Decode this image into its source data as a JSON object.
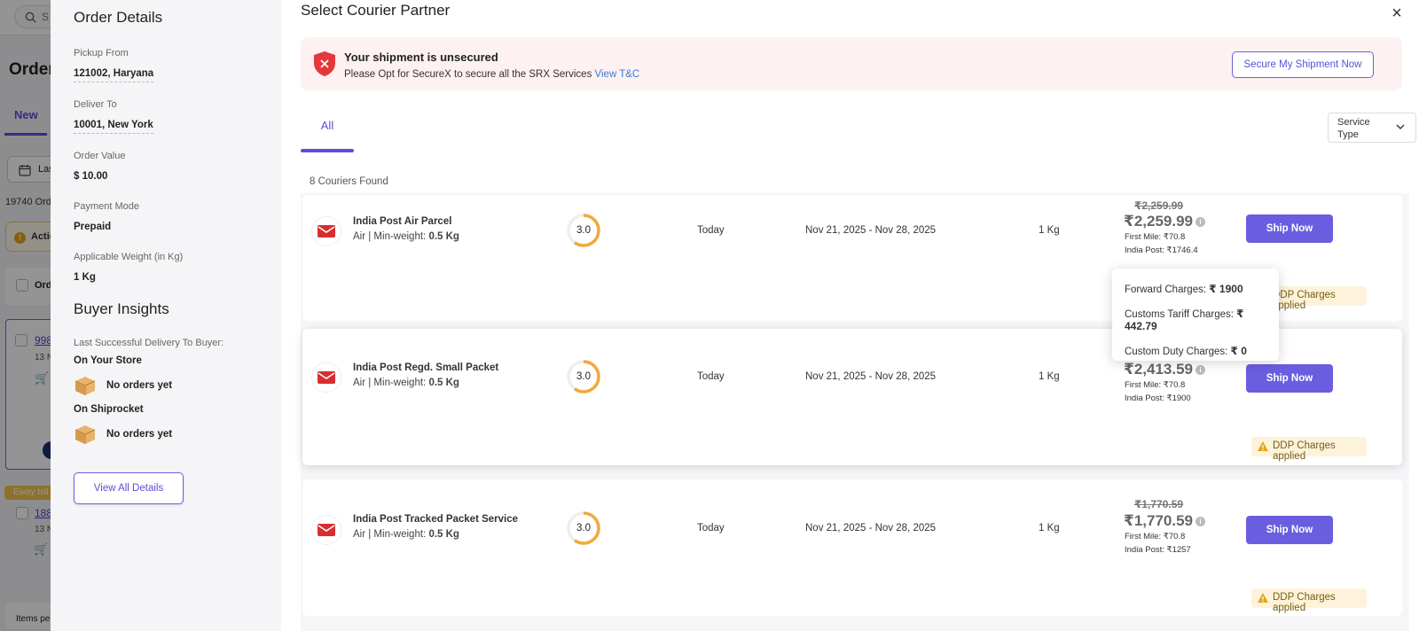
{
  "background": {
    "search_placeholder": "S",
    "page_title": "Order",
    "tab_new": "New",
    "date_filter": "Las",
    "order_count": "19740 Ord",
    "action_label": "Actio",
    "header_col": "Ord",
    "order1_id": "998",
    "order1_date": "13 N",
    "eway_badge": "Eway bill",
    "order2_id": "188",
    "order2_date": "13 N",
    "items_per_page": "Items per"
  },
  "order_details": {
    "title": "Order Details",
    "fields": [
      {
        "label": "Pickup From",
        "value": "121002, Haryana"
      },
      {
        "label": "Deliver To",
        "value": "10001, New York"
      },
      {
        "label": "Order Value",
        "value": "$ 10.00"
      },
      {
        "label": "Payment Mode",
        "value": "Prepaid"
      },
      {
        "label": "Applicable Weight (in Kg)",
        "value": "1 Kg"
      }
    ]
  },
  "buyer_insights": {
    "title": "Buyer Insights",
    "subtitle": "Last Successful Delivery To Buyer:",
    "store_label": "On Your Store",
    "store_value": "No orders yet",
    "shiprocket_label": "On Shiprocket",
    "shiprocket_value": "No orders yet",
    "view_all_label": "View All Details"
  },
  "courier_modal": {
    "title": "Select Courier Partner",
    "close_icon": "×",
    "banner": {
      "title": "Your shipment is unsecured",
      "subtitle": "Please Opt for SecureX to secure all the SRX Services",
      "link": "View T&C",
      "button": "Secure My Shipment Now"
    },
    "tab_all": "All",
    "service_type_label": "Service Type",
    "found_text": "8 Couriers Found",
    "couriers": [
      {
        "name": "India Post Air Parcel",
        "mode": "Air | Min-weight:",
        "min_weight": "0.5 Kg",
        "rating": "3.0",
        "rating_fraction": 0.6,
        "pickup": "Today",
        "edd": "Nov 21, 2025 - Nov 28, 2025",
        "weight": "1 Kg",
        "strike_price": "₹2,259.99",
        "price": "₹2,259.99",
        "first_mile": "First Mile: ₹70.8",
        "india_post": "India Post: ₹1746.4",
        "ship_label": "Ship Now",
        "ddp": "DDP Charges applied"
      },
      {
        "name": "India Post Regd. Small Packet",
        "mode": "Air | Min-weight:",
        "min_weight": "0.5 Kg",
        "rating": "3.0",
        "rating_fraction": 0.6,
        "pickup": "Today",
        "edd": "Nov 21, 2025 - Nov 28, 2025",
        "weight": "1 Kg",
        "strike_price": "",
        "price": "₹2,413.59",
        "first_mile": "First Mile: ₹70.8",
        "india_post": "India Post: ₹1900",
        "ship_label": "Ship Now",
        "ddp": "DDP Charges applied"
      },
      {
        "name": "India Post Tracked Packet Service",
        "mode": "Air | Min-weight:",
        "min_weight": "0.5 Kg",
        "rating": "3.0",
        "rating_fraction": 0.6,
        "pickup": "Today",
        "edd": "Nov 21, 2025 - Nov 28, 2025",
        "weight": "1 Kg",
        "strike_price": "₹1,770.59",
        "price": "₹1,770.59",
        "first_mile": "First Mile: ₹70.8",
        "india_post": "India Post: ₹1257",
        "ship_label": "Ship Now",
        "ddp": "DDP Charges applied"
      }
    ],
    "tooltip": {
      "forward_label": "Forward Charges:",
      "forward_value": "₹ 1900",
      "customs_tariff_label": "Customs Tariff Charges:",
      "customs_tariff_value": "₹ 442.79",
      "custom_duty_label": "Custom Duty Charges:",
      "custom_duty_value": "₹ 0"
    }
  },
  "colors": {
    "accent": "#6b5de0",
    "rating_ring": "#f2a93b",
    "shield_red": "#e5383b",
    "ddp_bg": "#fdf3da"
  }
}
